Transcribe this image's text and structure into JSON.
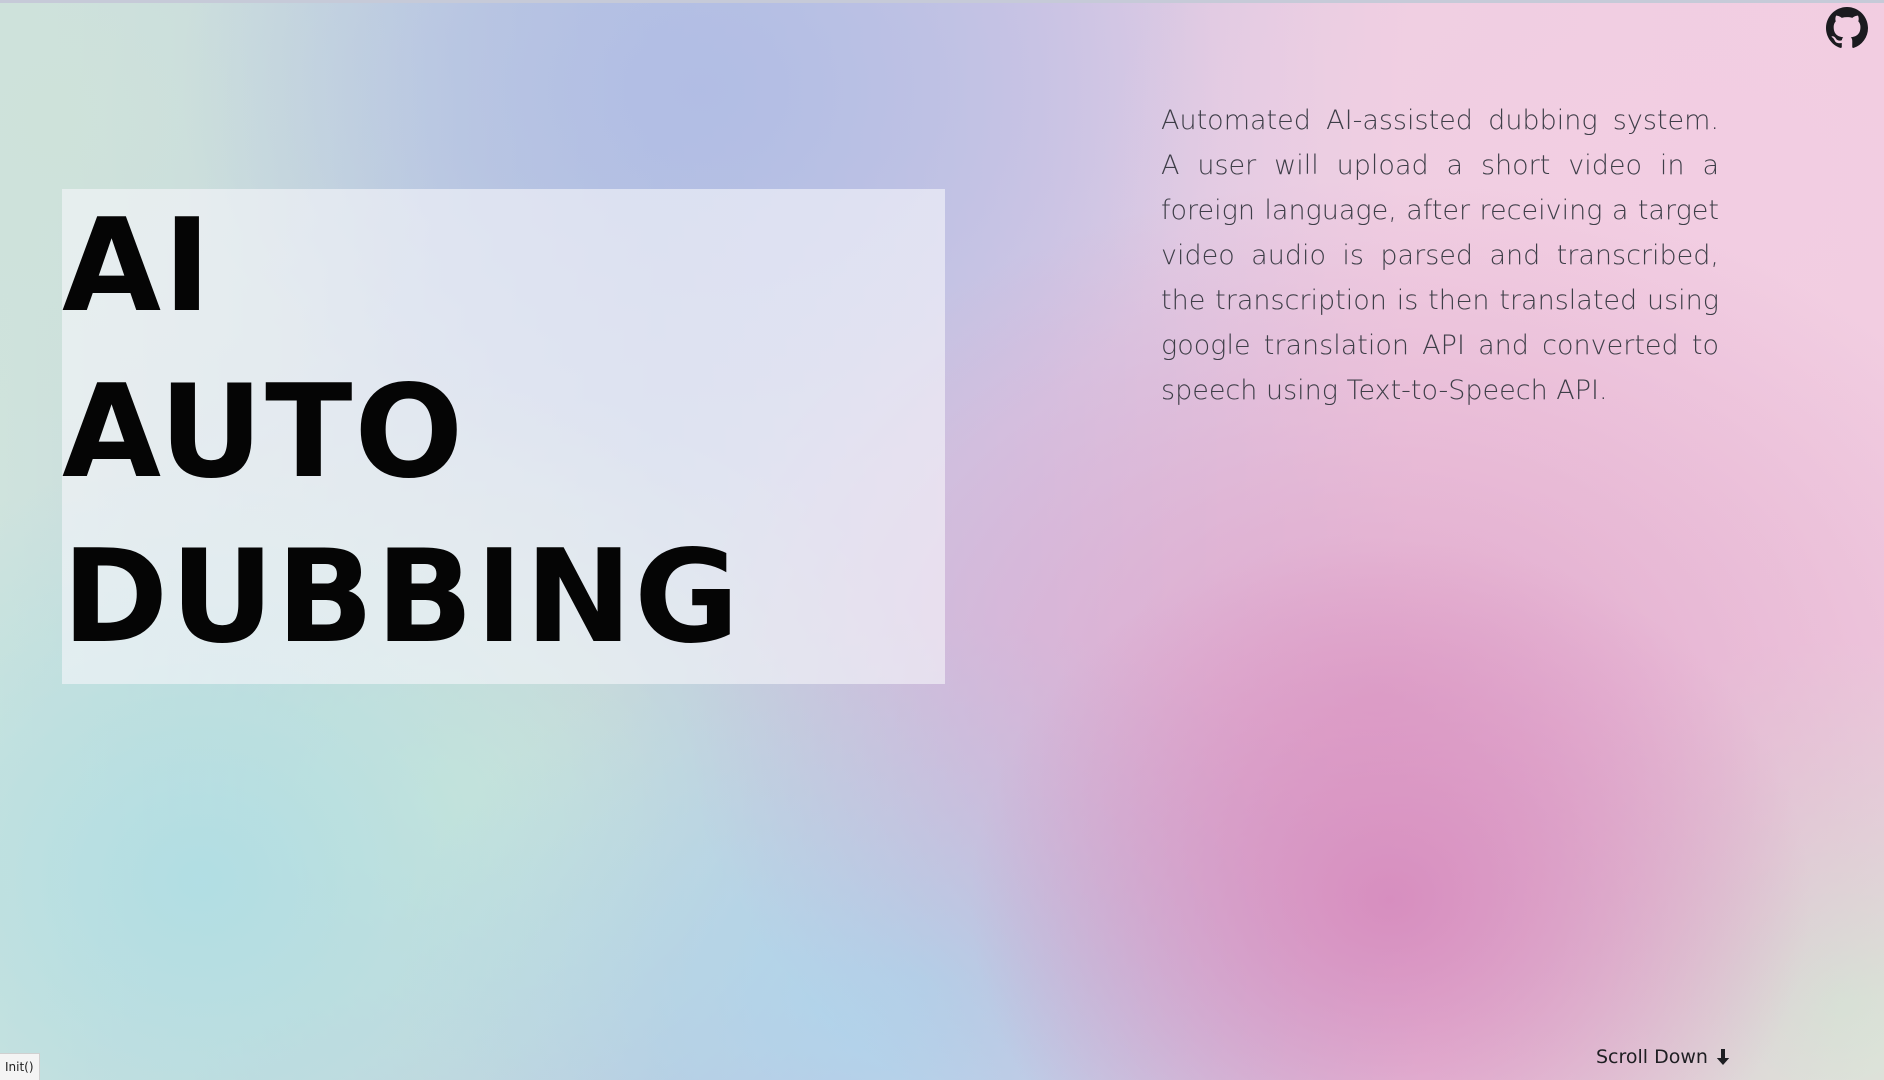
{
  "hero": {
    "title_lines": [
      "AI",
      "AUTO",
      "DUBBING"
    ],
    "description": "Automated AI-assisted dubbing system. A user will upload a short video in a foreign language, after receiving a target video audio is parsed and transcribed, the transcription is then translated using google translation API and converted to speech using Text-to-Speech API."
  },
  "header": {
    "github_icon": "github-icon"
  },
  "footer": {
    "scroll_label": "Scroll Down",
    "scroll_icon": "arrow-down-icon"
  },
  "status_bar": {
    "text": "Init()"
  },
  "colors": {
    "title_text": "#050505",
    "body_text": "#3e3e48",
    "accent_pink": "#d68cbe",
    "accent_blue": "#acd6ec"
  }
}
